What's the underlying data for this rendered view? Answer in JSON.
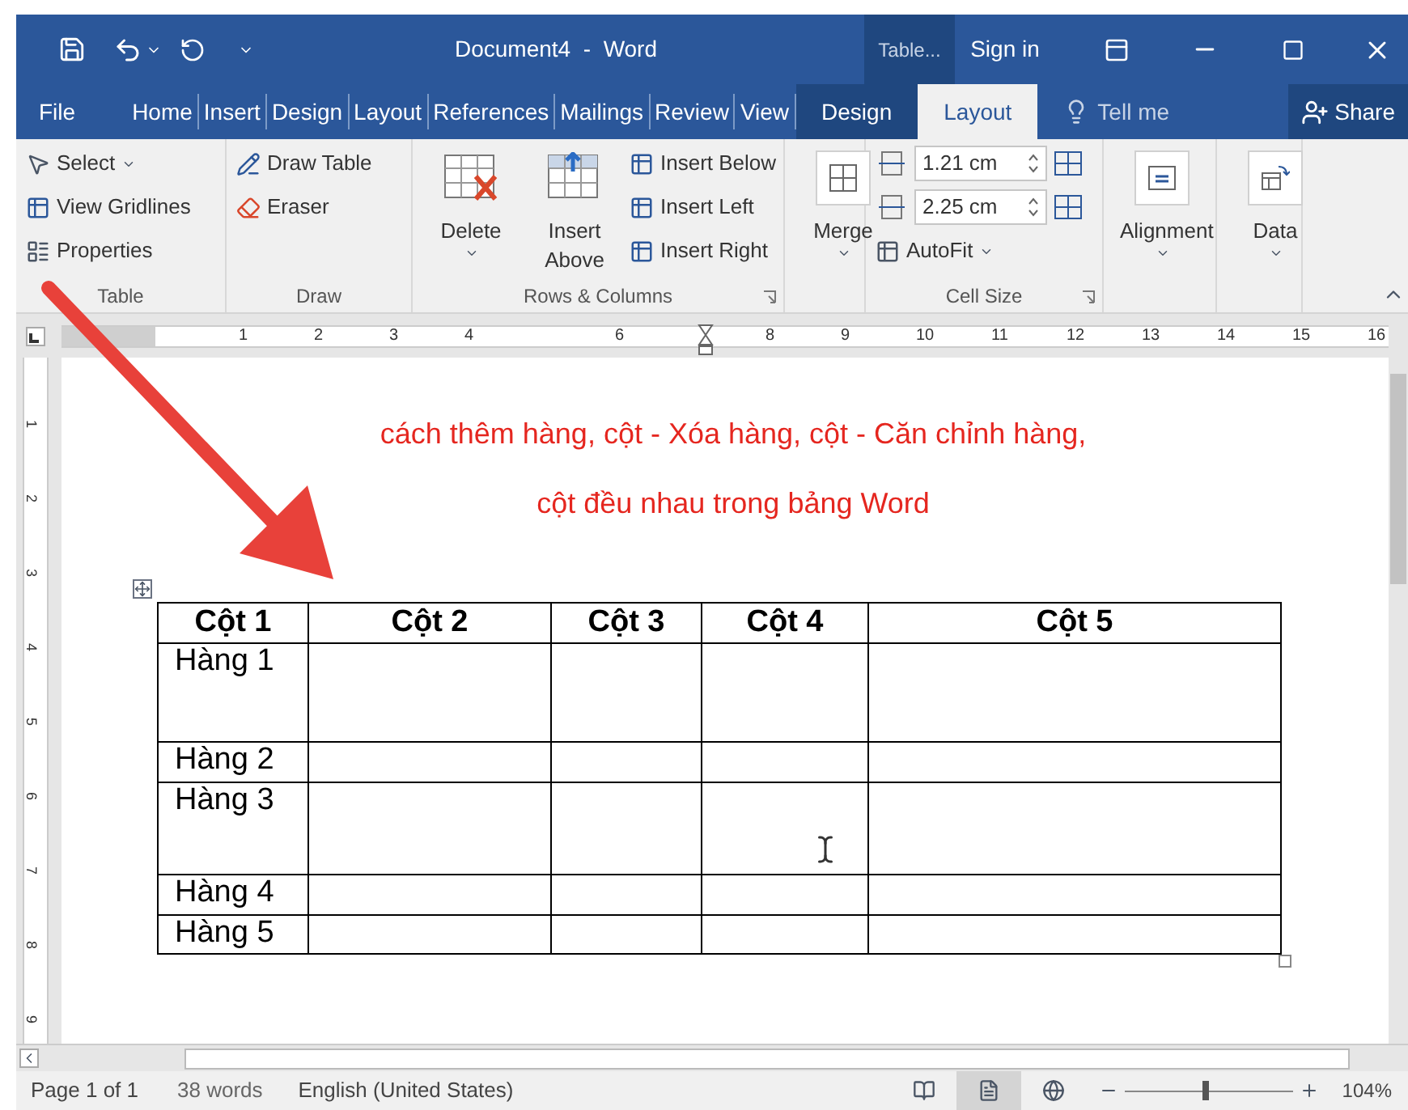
{
  "window": {
    "title": "Document4  -  Word",
    "context_group": "Table...",
    "sign_in": "Sign in"
  },
  "tabs": [
    {
      "label": "File",
      "selected": false,
      "kind": "file"
    },
    {
      "label": "Home",
      "selected": false,
      "kind": "main"
    },
    {
      "label": "Insert",
      "selected": false,
      "kind": "main"
    },
    {
      "label": "Design",
      "selected": false,
      "kind": "main"
    },
    {
      "label": "Layout",
      "selected": false,
      "kind": "main"
    },
    {
      "label": "References",
      "selected": false,
      "kind": "main"
    },
    {
      "label": "Mailings",
      "selected": false,
      "kind": "main"
    },
    {
      "label": "Review",
      "selected": false,
      "kind": "main"
    },
    {
      "label": "View",
      "selected": false,
      "kind": "main"
    },
    {
      "label": "Design",
      "selected": false,
      "kind": "context"
    },
    {
      "label": "Layout",
      "selected": true,
      "kind": "context"
    }
  ],
  "tell_me": "Tell me",
  "share": "Share",
  "ribbon": [
    {
      "label": "Table",
      "items": [
        {
          "kind": "small",
          "label": "Select",
          "dropdown": true
        },
        {
          "kind": "small",
          "label": "View Gridlines",
          "dropdown": false
        },
        {
          "kind": "small",
          "label": "Properties",
          "dropdown": false
        }
      ]
    },
    {
      "label": "Draw",
      "items": [
        {
          "kind": "small",
          "label": "Draw Table",
          "dropdown": false
        },
        {
          "kind": "small",
          "label": "Eraser",
          "dropdown": false
        }
      ]
    },
    {
      "label": "Rows & Columns",
      "launcher": true,
      "items": [
        {
          "kind": "big",
          "label": "Delete",
          "dropdown": true
        },
        {
          "kind": "big",
          "label": "Insert Above",
          "dropdown": false
        },
        {
          "kind": "small",
          "label": "Insert Below",
          "dropdown": false
        },
        {
          "kind": "small",
          "label": "Insert Left",
          "dropdown": false
        },
        {
          "kind": "small",
          "label": "Insert Right",
          "dropdown": false
        }
      ]
    },
    {
      "items": [
        {
          "kind": "big",
          "label": "Merge",
          "dropdown": true
        }
      ]
    },
    {
      "label": "Cell Size",
      "launcher": true,
      "items": [
        {
          "kind": "spin",
          "value": "1.21 cm"
        },
        {
          "kind": "spin",
          "value": "2.25 cm"
        },
        {
          "kind": "small",
          "label": "AutoFit",
          "dropdown": true
        }
      ]
    },
    {
      "items": [
        {
          "kind": "big",
          "label": "Alignment",
          "dropdown": true
        }
      ]
    },
    {
      "items": [
        {
          "kind": "big",
          "label": "Data",
          "dropdown": true
        }
      ]
    }
  ],
  "ruler": [
    "1",
    "2",
    "3",
    "4",
    "6",
    "8",
    "9",
    "10",
    "11",
    "12",
    "13",
    "14",
    "15",
    "16"
  ],
  "vertical_ruler": [
    "1",
    "2",
    "3",
    "4",
    "5",
    "6",
    "7",
    "8",
    "9"
  ],
  "heading": [
    "cách thêm hàng, cột - Xóa hàng, cột - Căn chỉnh hàng,",
    "cột đều nhau trong bảng Word"
  ],
  "table": {
    "columns": [
      "Cột 1",
      "Cột 2",
      "Cột 3",
      "Cột 4",
      "Cột 5"
    ],
    "rows": [
      {
        "label": "Hàng 1"
      },
      {
        "label": "Hàng 2"
      },
      {
        "label": "Hàng 3"
      },
      {
        "label": "Hàng 4"
      },
      {
        "label": "Hàng 5"
      }
    ]
  },
  "status_bar": {
    "page": "Page 1 of 1",
    "words": "38 words",
    "language": "English (United States)",
    "views": [
      {
        "kind": "read",
        "selected": false
      },
      {
        "kind": "print",
        "selected": true
      },
      {
        "kind": "web",
        "selected": false
      }
    ],
    "zoom": {
      "level": 0.46,
      "reading": "104%"
    }
  }
}
